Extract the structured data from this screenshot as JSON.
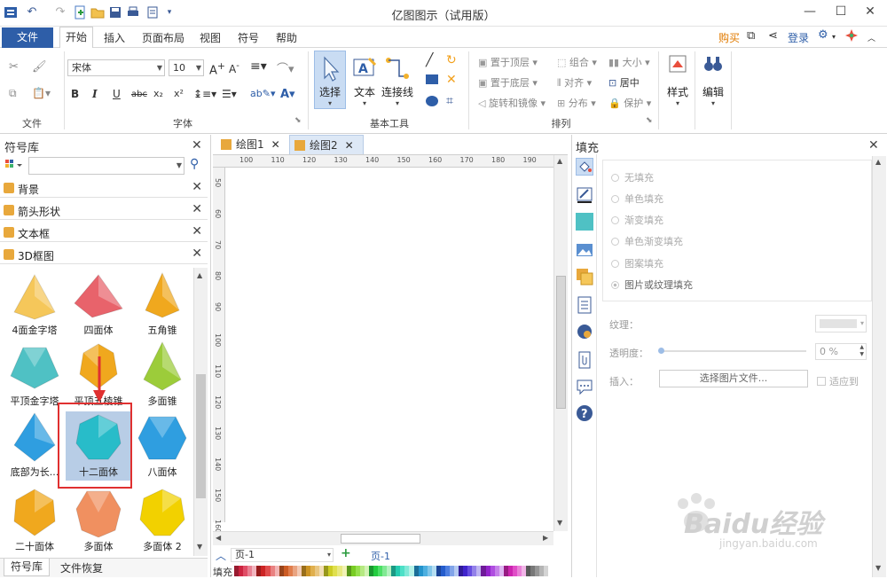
{
  "app": {
    "title": "亿图图示（试用版）"
  },
  "menu": {
    "file": "文件",
    "tabs": [
      "开始",
      "插入",
      "页面布局",
      "视图",
      "符号",
      "帮助"
    ],
    "buy": "购买",
    "login": "登录"
  },
  "ribbon": {
    "groups": {
      "file": "文件",
      "font": "字体",
      "basic_tools": "基本工具",
      "arrange": "排列"
    },
    "font_name": "宋体",
    "font_size": "10",
    "select": "选择",
    "text": "文本",
    "connector": "连接线",
    "to_top": "置于顶层",
    "to_bottom": "置于底层",
    "rotate_mirror": "旋转和镜像",
    "group": "组合",
    "align": "对齐",
    "distribute": "分布",
    "size": "大小",
    "center": "居中",
    "protect": "保护",
    "style": "样式",
    "edit": "编辑"
  },
  "library": {
    "title": "符号库",
    "categories": [
      "背景",
      "箭头形状",
      "文本框",
      "3D框图"
    ],
    "shapes": [
      {
        "name": "4面金字塔",
        "color": "#f5c75a"
      },
      {
        "name": "四面体",
        "color": "#e8636b"
      },
      {
        "name": "五角锥",
        "color": "#f0a81e"
      },
      {
        "name": "平顶金字塔",
        "color": "#4fc1c4"
      },
      {
        "name": "平顶五棱锥",
        "color": "#f0a81e"
      },
      {
        "name": "多面锥",
        "color": "#9ccc3a"
      },
      {
        "name": "底部为长...",
        "color": "#2f9ee0"
      },
      {
        "name": "十二面体",
        "color": "#28bcc9"
      },
      {
        "name": "八面体",
        "color": "#2f9ee0"
      },
      {
        "name": "二十面体",
        "color": "#f0a81e"
      },
      {
        "name": "多面体",
        "color": "#f09060"
      },
      {
        "name": "多面体 2",
        "color": "#f2d100"
      }
    ],
    "bottom_tabs": [
      "符号库",
      "文件恢复"
    ]
  },
  "canvas": {
    "tabs": [
      "绘图1",
      "绘图2"
    ],
    "ruler_h": [
      "100",
      "110",
      "120",
      "130",
      "140",
      "150",
      "160",
      "170",
      "180",
      "190"
    ],
    "ruler_v": [
      "50",
      "60",
      "70",
      "80",
      "90",
      "100",
      "110",
      "120",
      "130",
      "140",
      "150",
      "160"
    ],
    "page_select": "页-1",
    "page_tab": "页-1",
    "fill_label": "填充"
  },
  "fill_panel": {
    "title": "填充",
    "options": [
      "无填充",
      "单色填充",
      "渐变填充",
      "单色渐变填充",
      "图案填充",
      "图片或纹理填充"
    ],
    "texture_label": "纹理：",
    "opacity_label": "透明度：",
    "opacity_value": "0 %",
    "insert_label": "插入：",
    "choose_button": "选择图片文件...",
    "fit_label": "适应到"
  },
  "watermark": {
    "text": "Baidu经验",
    "url": "jingyan.baidu.com"
  },
  "colors": {
    "accent": "#2e5ea8",
    "highlight": "#e03030"
  }
}
